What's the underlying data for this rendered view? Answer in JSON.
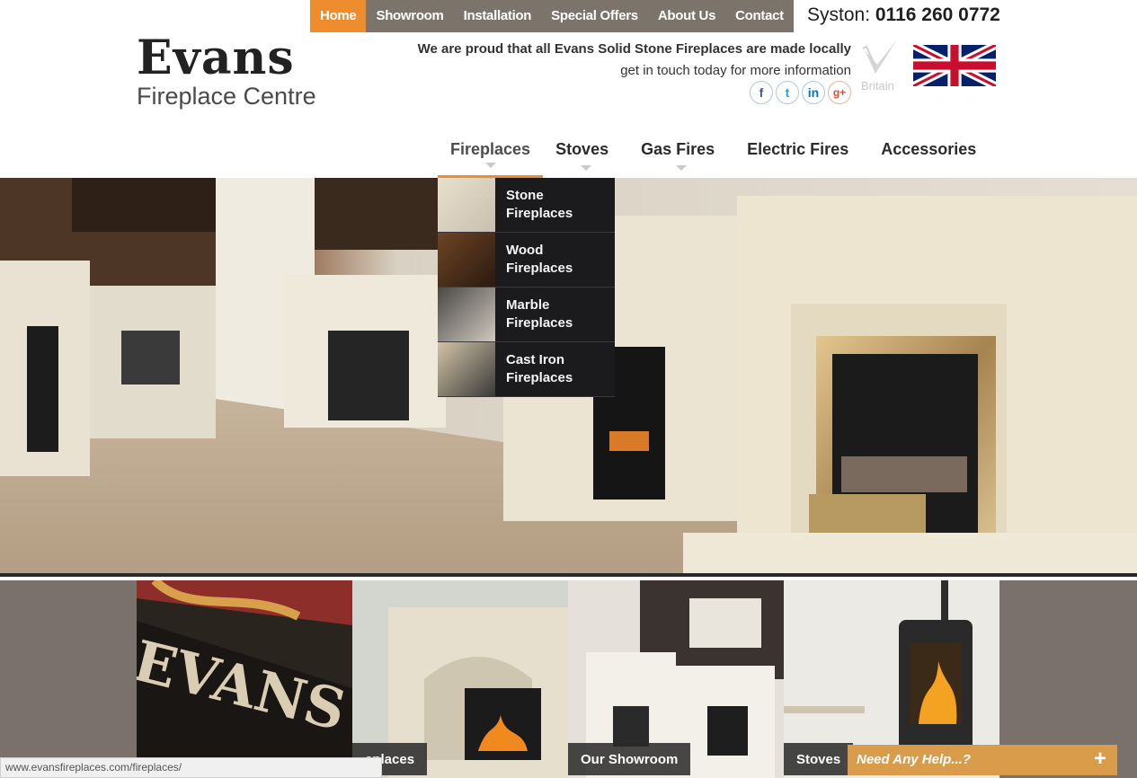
{
  "topnav": {
    "items": [
      {
        "label": "Home",
        "active": true
      },
      {
        "label": "Showroom"
      },
      {
        "label": "Installation"
      },
      {
        "label": "Special Offers"
      },
      {
        "label": "About Us"
      },
      {
        "label": "Contact"
      }
    ],
    "phone_prefix": "Syston: ",
    "phone_number": "0116 260 0772"
  },
  "logo": {
    "word": "Evans",
    "sub": "Fireplace Centre"
  },
  "tagline": {
    "line1": "We are proud that all Evans Solid Stone Fireplaces are made locally",
    "line2": "get in touch today for more information"
  },
  "social": [
    {
      "glyph": "f",
      "icon": "facebook-icon"
    },
    {
      "glyph": "t",
      "icon": "twitter-icon"
    },
    {
      "glyph": "in",
      "icon": "linkedin-icon"
    },
    {
      "glyph": "g+",
      "icon": "google-plus-icon"
    }
  ],
  "madein": {
    "text": "Britain"
  },
  "mainnav": {
    "items": [
      {
        "label": "Fireplaces",
        "active": true
      },
      {
        "label": "Stoves"
      },
      {
        "label": "Gas Fires"
      },
      {
        "label": "Electric Fires"
      },
      {
        "label": "Accessories"
      }
    ]
  },
  "dropdown": {
    "items": [
      {
        "line1": "Stone",
        "line2": "Fireplaces"
      },
      {
        "line1": "Wood",
        "line2": "Fireplaces"
      },
      {
        "line1": "Marble",
        "line2": "Fireplaces"
      },
      {
        "line1": "Cast Iron",
        "line2": "Fireplaces"
      }
    ]
  },
  "tiles": [
    {
      "label": ""
    },
    {
      "label": "eplaces"
    },
    {
      "label": "Our Showroom"
    },
    {
      "label": "Stoves"
    }
  ],
  "statusbar": {
    "url": "www.evansfireplaces.com/fireplaces/"
  },
  "help": {
    "label": "Need Any Help...?",
    "plus": "+"
  },
  "colors": {
    "accent": "#ef8c2e",
    "topbar": "#7c736a",
    "dropdown": "#1b1b1d",
    "help": "#d99c4b"
  }
}
